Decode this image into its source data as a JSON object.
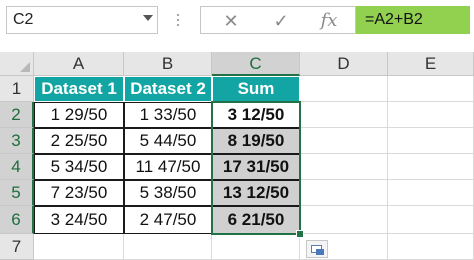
{
  "name_box": {
    "value": "C2"
  },
  "formula_bar": {
    "cancel_icon": "✕",
    "enter_icon": "✓",
    "fx_label": "fx",
    "formula": "=A2+B2"
  },
  "columns": [
    "A",
    "B",
    "C",
    "D",
    "E"
  ],
  "rows": [
    "1",
    "2",
    "3",
    "4",
    "5",
    "6",
    "7"
  ],
  "selected": {
    "column": "C",
    "row_start": 2,
    "row_end": 6
  },
  "table": {
    "headers": [
      "Dataset 1",
      "Dataset 2",
      "Sum"
    ],
    "rows": [
      [
        "1 29/50",
        "1 33/50",
        "3 12/50"
      ],
      [
        "2 25/50",
        "5 44/50",
        "8 19/50"
      ],
      [
        "5 34/50",
        "11 47/50",
        "17 31/50"
      ],
      [
        "7 23/50",
        "5 38/50",
        "13 12/50"
      ],
      [
        "3 24/50",
        "2 47/50",
        "6 21/50"
      ]
    ]
  },
  "colors": {
    "header_fill": "#13a4a4",
    "formula_fill": "#92d050",
    "selection": "#217346"
  }
}
